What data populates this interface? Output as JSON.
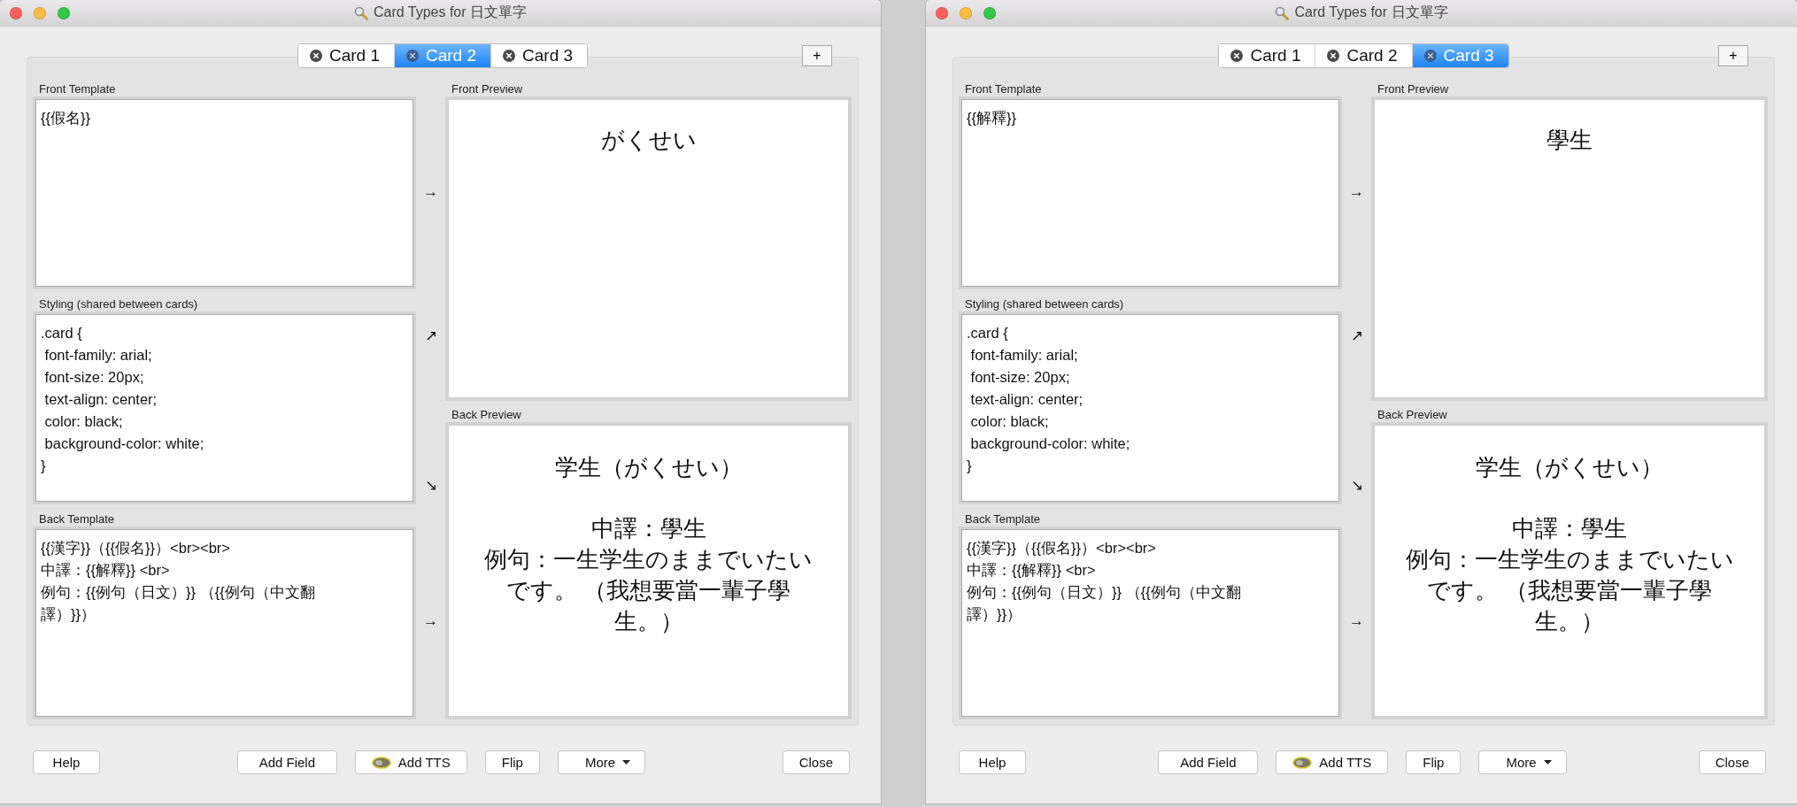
{
  "windows": [
    {
      "title": "Card Types for 日文單字",
      "tabs": [
        {
          "label": "Card 1",
          "selected": false
        },
        {
          "label": "Card 2",
          "selected": true
        },
        {
          "label": "Card 3",
          "selected": false
        }
      ],
      "add_tab": "+",
      "front_template": {
        "label": "Front Template",
        "lines": [
          "{{假名}}"
        ]
      },
      "styling": {
        "label": "Styling (shared between cards)",
        "lines": [
          ".card {",
          " font-family: arial;",
          " font-size: 20px;",
          " text-align: center;",
          " color: black;",
          " background-color: white;",
          "}"
        ]
      },
      "back_template": {
        "label": "Back Template",
        "lines": [
          "{{漢字}}（{{假名}}）<br><br>",
          "中譯：{{解釋}} <br>",
          "例句：{{例句（日文）}} （{{例句（中文翻譯）}}）"
        ]
      },
      "arrows": [
        "→",
        "↗",
        "↘",
        "→"
      ],
      "front_preview": {
        "label": "Front Preview",
        "text": "がくせい"
      },
      "back_preview": {
        "label": "Back Preview",
        "heading": "学生（がくせい）",
        "lines": [
          "中譯：學生",
          "例句：一生学生のままでいたいです。 （我想要當一輩子學生。）"
        ]
      },
      "button_bar": {
        "left": [
          {
            "label": "Help",
            "kind": "plain"
          }
        ],
        "middle": [
          {
            "label": "Add Field",
            "kind": "plain"
          },
          {
            "label": "Add TTS",
            "kind": "tts"
          },
          {
            "label": "Flip",
            "kind": "plain"
          },
          {
            "label": "More",
            "kind": "menu"
          }
        ],
        "right": [
          {
            "label": "Close",
            "kind": "plain"
          }
        ]
      }
    },
    {
      "title": "Card Types for 日文單字",
      "tabs": [
        {
          "label": "Card 1",
          "selected": false
        },
        {
          "label": "Card 2",
          "selected": false
        },
        {
          "label": "Card 3",
          "selected": true
        }
      ],
      "add_tab": "+",
      "front_template": {
        "label": "Front Template",
        "lines": [
          "{{解釋}}"
        ]
      },
      "styling": {
        "label": "Styling (shared between cards)",
        "lines": [
          ".card {",
          " font-family: arial;",
          " font-size: 20px;",
          " text-align: center;",
          " color: black;",
          " background-color: white;",
          "}"
        ]
      },
      "back_template": {
        "label": "Back Template",
        "lines": [
          "{{漢字}}（{{假名}}）<br><br>",
          "中譯：{{解釋}} <br>",
          "例句：{{例句（日文）}} （{{例句（中文翻譯）}}）"
        ]
      },
      "arrows": [
        "→",
        "↗",
        "↘",
        "→"
      ],
      "front_preview": {
        "label": "Front Preview",
        "text": "學生"
      },
      "back_preview": {
        "label": "Back Preview",
        "heading": "学生（がくせい）",
        "lines": [
          "中譯：學生",
          "例句：一生学生のままでいたいです。 （我想要當一輩子學生。）"
        ]
      },
      "button_bar": {
        "left": [
          {
            "label": "Help",
            "kind": "plain"
          }
        ],
        "middle": [
          {
            "label": "Add Field",
            "kind": "plain"
          },
          {
            "label": "Add TTS",
            "kind": "tts"
          },
          {
            "label": "Flip",
            "kind": "plain"
          },
          {
            "label": "More",
            "kind": "menu"
          }
        ],
        "right": [
          {
            "label": "Close",
            "kind": "plain"
          }
        ]
      }
    }
  ]
}
